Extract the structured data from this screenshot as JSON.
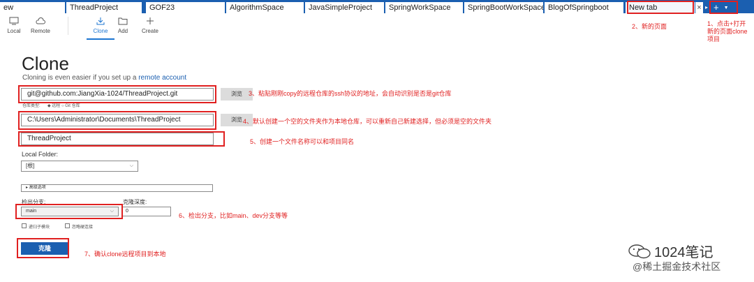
{
  "tabs": [
    {
      "label": "ew"
    },
    {
      "label": "ThreadProject"
    },
    {
      "label": "GOF23"
    },
    {
      "label": "AlgorithmSpace"
    },
    {
      "label": "JavaSimpleProject"
    },
    {
      "label": "SpringWorkSpace"
    },
    {
      "label": "SpringBootWorkSpace"
    },
    {
      "label": "BlogOfSpringboot"
    },
    {
      "label": "New tab",
      "active": true
    }
  ],
  "tab_close": "×",
  "tab_add": "+",
  "toolbar": {
    "local": "Local",
    "remote": "Remote",
    "clone": "Clone",
    "add": "Add",
    "create": "Create"
  },
  "clone": {
    "title": "Clone",
    "subtitle_prefix": "Cloning is even easier if you set up a ",
    "subtitle_link": "remote account",
    "url_value": "git@github.com:JiangXia-1024/ThreadProject.git",
    "browse_label": "浏览",
    "repo_type_label": "仓库类型:",
    "repo_type_value": "◆ 远程  ○ Git 仓库",
    "path_value": "C:\\Users\\Administrator\\Documents\\ThreadProject",
    "name_value": "ThreadProject",
    "local_folder_label": "Local Folder:",
    "local_folder_value": "[根]",
    "advanced_label": "高级选项",
    "checkout_branch_label": "检出分支:",
    "checkout_branch_value": "main",
    "clone_depth_label": "克隆深度:",
    "clone_depth_value": "0",
    "recurse_submodules_label": "递归子模块",
    "no_hardlinks_label": "忽略硬连接",
    "submit_label": "克隆"
  },
  "annotations": {
    "a1": "1、点击+打开新的页面clone项目",
    "a2": "2、新的页面",
    "a3": "3、粘贴刚刚copy的远程仓库的ssh协议的地址，会自动识别是否是git仓库",
    "a4": "4、默认创建一个空的文件夹作为本地仓库，可以重新自己新建选择，但必须是空的文件夹",
    "a5": "5、创建一个文件名称可以和项目同名",
    "a6": "6、检出分支，比如main、dev分支等等",
    "a7": "7、确认clone远程项目到本地"
  },
  "watermark": {
    "title": "1024笔记",
    "subtitle": "@稀土掘金技术社区"
  },
  "colors": {
    "accent": "#1b5fb0",
    "annotation": "#e02020"
  }
}
